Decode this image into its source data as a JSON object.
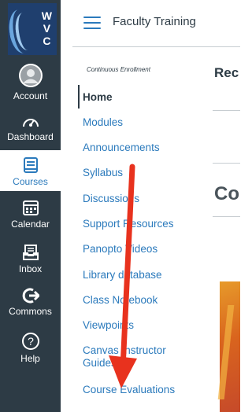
{
  "global_nav": {
    "logo_letters": [
      "W",
      "V",
      "C"
    ],
    "items": [
      {
        "label": "Account",
        "icon": "user-avatar-icon"
      },
      {
        "label": "Dashboard",
        "icon": "speedometer-icon"
      },
      {
        "label": "Courses",
        "icon": "book-icon"
      },
      {
        "label": "Calendar",
        "icon": "calendar-icon"
      },
      {
        "label": "Inbox",
        "icon": "inbox-icon"
      },
      {
        "label": "Commons",
        "icon": "commons-arrow-icon"
      },
      {
        "label": "Help",
        "icon": "question-circle-icon"
      }
    ]
  },
  "header": {
    "title": "Faculty Training"
  },
  "course_nav": {
    "term": "Continuous Enrollment",
    "items": [
      {
        "label": "Home"
      },
      {
        "label": "Modules"
      },
      {
        "label": "Announcements"
      },
      {
        "label": "Syllabus"
      },
      {
        "label": "Discussions"
      },
      {
        "label": "Support Resources"
      },
      {
        "label": "Panopto Videos"
      },
      {
        "label": "Library database"
      },
      {
        "label": "Class Notebook"
      },
      {
        "label": "Viewpoints"
      },
      {
        "label": "Canvas Instructor Guides"
      },
      {
        "label": "Course Evaluations"
      }
    ],
    "active_item": "Home"
  },
  "content": {
    "heading_1": "Rec",
    "heading_2": "Co"
  },
  "colors": {
    "nav_bg": "#2d3b45",
    "link": "#2b7abc",
    "arrow": "#e8321e"
  }
}
